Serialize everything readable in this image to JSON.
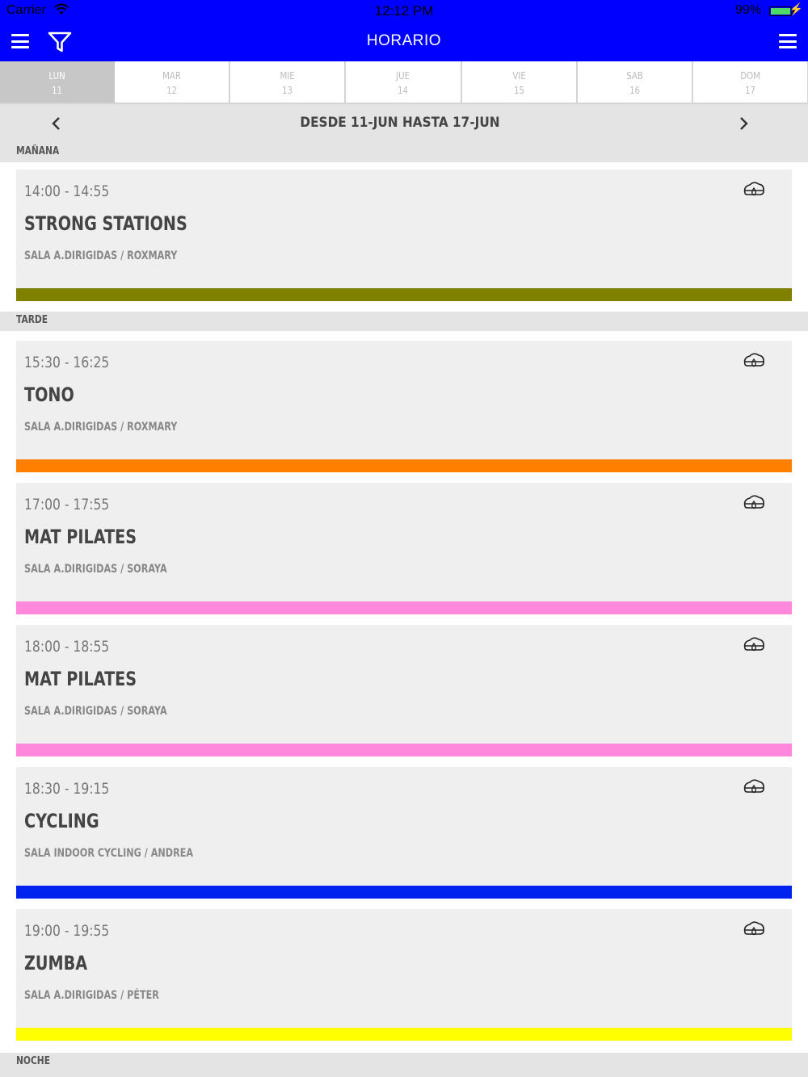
{
  "status_bar": {
    "carrier": "Carrier",
    "time": "12:12 PM",
    "battery": "99%"
  },
  "header": {
    "title": "HORARIO"
  },
  "days": [
    {
      "name": "LUN",
      "num": "11",
      "active": true
    },
    {
      "name": "MAR",
      "num": "12",
      "active": false
    },
    {
      "name": "MIE",
      "num": "13",
      "active": false
    },
    {
      "name": "JUE",
      "num": "14",
      "active": false
    },
    {
      "name": "VIE",
      "num": "15",
      "active": false
    },
    {
      "name": "SAB",
      "num": "16",
      "active": false
    },
    {
      "name": "DOM",
      "num": "17",
      "active": false
    }
  ],
  "range": {
    "label": "DESDE 11-JUN HASTA 17-JUN"
  },
  "sections": {
    "morning": "MAÑANA",
    "afternoon": "TARDE",
    "night": "NOCHE"
  },
  "classes": [
    {
      "time": "14:00 - 14:55",
      "name": "STRONG STATIONS",
      "sub": "SALA A.DIRIGIDAS / ROXMARY",
      "color": "#808000",
      "icon": "cloud-drop-icon"
    },
    {
      "time": "15:30 - 16:25",
      "name": "TONO",
      "sub": "SALA A.DIRIGIDAS / ROXMARY",
      "color": "#ff8000",
      "icon": "cloud-drop-icon"
    },
    {
      "time": "17:00 - 17:55",
      "name": "MAT PILATES",
      "sub": "SALA A.DIRIGIDAS / SORAYA",
      "color": "#ff88dd",
      "icon": "cloud-drop-icon"
    },
    {
      "time": "18:00 - 18:55",
      "name": "MAT PILATES",
      "sub": "SALA A.DIRIGIDAS / SORAYA",
      "color": "#ff88dd",
      "icon": "cloud-drop-icon"
    },
    {
      "time": "18:30 - 19:15",
      "name": "CYCLING",
      "sub": "SALA INDOOR CYCLING / ANDREA",
      "color": "#0022ee",
      "icon": "cloud-drop-icon"
    },
    {
      "time": "19:00 - 19:55",
      "name": "ZUMBA",
      "sub": "SALA A.DIRIGIDAS / PÉTER",
      "color": "#ffff00",
      "icon": "cloud-drop-icon"
    }
  ],
  "colors": {
    "header": "#0000ff",
    "active_day": "#c7c7c7",
    "section_bg": "#e4e4e4",
    "card_bg": "#efefef"
  }
}
